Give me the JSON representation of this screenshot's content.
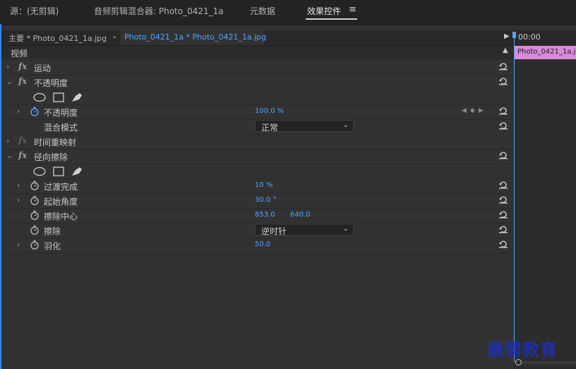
{
  "tabs": {
    "source": "源：(无剪辑)",
    "audio_mixer": "音频剪辑混合器: Photo_0421_1a",
    "metadata": "元数据",
    "effect_controls": "效果控件",
    "menu_icon": "hamburger-icon"
  },
  "sequence": {
    "master": "主要 * Photo_0421_1a.jpg",
    "clip": "Photo_0421_1a * Photo_0421_1a.jpg"
  },
  "timeline": {
    "timecode": "00:00",
    "clip_label": "Photo_0421_1a.j"
  },
  "section": {
    "video": "视频"
  },
  "effects": {
    "motion": "运动",
    "opacity_group": "不透明度",
    "opacity_param": "不透明度",
    "opacity_value": "100.0 %",
    "blend_mode_label": "混合模式",
    "blend_mode_value": "正常",
    "time_remap": "时间重映射",
    "radial_wipe": "径向擦除",
    "transition_completion": "过渡完成",
    "transition_value": "10 %",
    "start_angle": "起始角度",
    "start_angle_value": "30.0 °",
    "wipe_center": "擦除中心",
    "wipe_center_x": "853.0",
    "wipe_center_y": "640.0",
    "wipe": "擦除",
    "wipe_value": "逆时针",
    "feather": "羽化",
    "feather_value": "50.0"
  },
  "fx_label": "fx",
  "watermark": "最需教育",
  "colors": {
    "accent": "#2d8ceb",
    "value_blue": "#4ea6ff",
    "clip_pink": "#d98ad9",
    "panel_bg": "#323232"
  }
}
